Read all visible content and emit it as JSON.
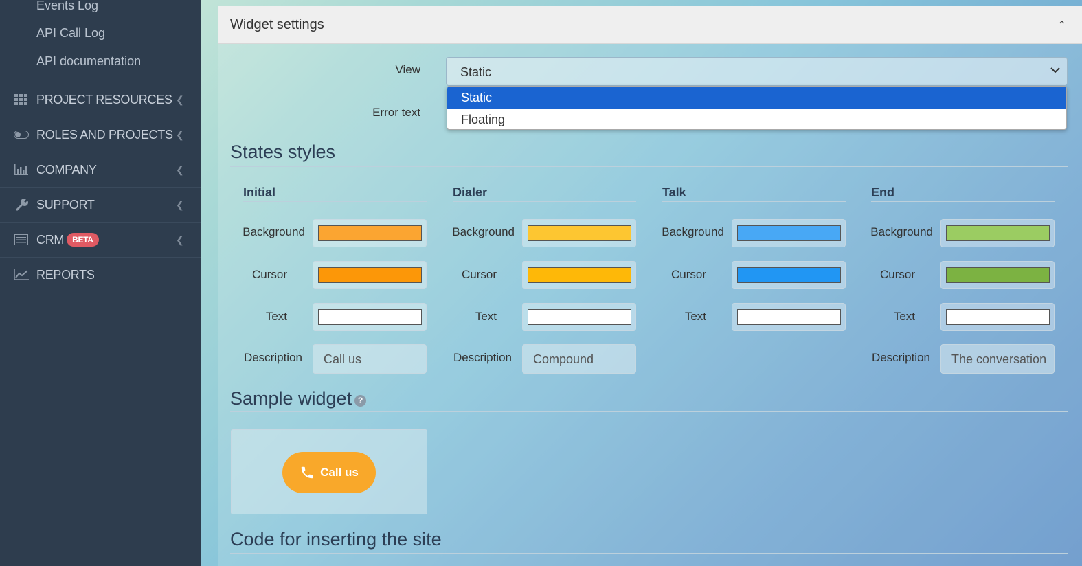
{
  "sidebar": {
    "sub_items": [
      "Events Log",
      "API Call Log",
      "API documentation"
    ],
    "items": [
      {
        "label": "PROJECT RESOURCES",
        "icon": "grid-icon"
      },
      {
        "label": "ROLES AND PROJECTS",
        "icon": "toggle-icon"
      },
      {
        "label": "COMPANY",
        "icon": "bar-chart-icon"
      },
      {
        "label": "SUPPORT",
        "icon": "wrench-icon"
      },
      {
        "label": "CRM",
        "icon": "list-icon",
        "badge": "BETA"
      },
      {
        "label": "REPORTS",
        "icon": "line-chart-icon"
      }
    ]
  },
  "panel": {
    "title": "Widget settings",
    "view_label": "View",
    "view_value": "Static",
    "view_options": [
      "Static",
      "Floating"
    ],
    "error_text_label": "Error text"
  },
  "states": {
    "title": "States styles",
    "row_labels": {
      "background": "Background",
      "cursor": "Cursor",
      "text": "Text",
      "description": "Description"
    },
    "columns": [
      {
        "name": "Initial",
        "background": "#fba531",
        "cursor": "#fc9708",
        "text": "#ffffff",
        "description": "Call us"
      },
      {
        "name": "Dialer",
        "background": "#fdc631",
        "cursor": "#feb808",
        "text": "#ffffff",
        "description": "Compound"
      },
      {
        "name": "Talk",
        "background": "#48a8f5",
        "cursor": "#2196f3",
        "text": "#ffffff",
        "description": null
      },
      {
        "name": "End",
        "background": "#9bcc62",
        "cursor": "#7cb242",
        "text": "#ffffff",
        "description": "The conversation"
      }
    ]
  },
  "sample": {
    "title": "Sample widget",
    "help": "?",
    "button_label": "Call us",
    "button_color": "#f9a82a"
  },
  "code": {
    "title": "Code for inserting the site"
  }
}
